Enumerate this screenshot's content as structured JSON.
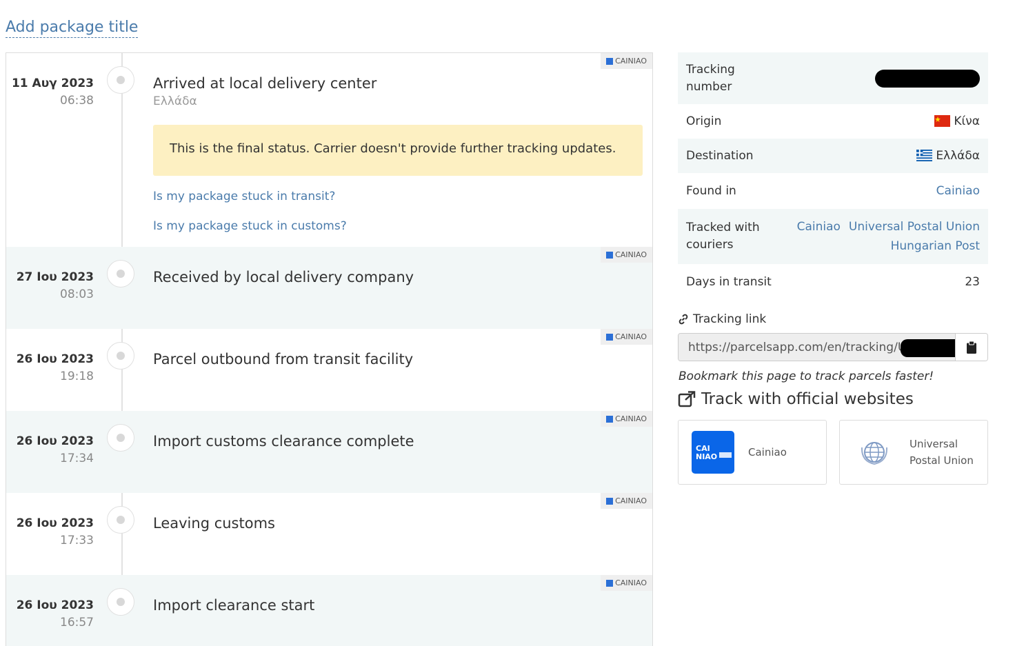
{
  "header": {
    "add_title": "Add package title"
  },
  "events": [
    {
      "date": "11 Αυγ 2023",
      "time": "06:38",
      "status": "Arrived at local delivery center",
      "location": "Ελλάδα",
      "carrier": "CAINIAO"
    },
    {
      "date": "27 Ιου 2023",
      "time": "08:03",
      "status": "Received by local delivery company",
      "carrier": "CAINIAO"
    },
    {
      "date": "26 Ιου 2023",
      "time": "19:18",
      "status": "Parcel outbound from transit facility",
      "carrier": "CAINIAO"
    },
    {
      "date": "26 Ιου 2023",
      "time": "17:34",
      "status": "Import customs clearance complete",
      "carrier": "CAINIAO"
    },
    {
      "date": "26 Ιου 2023",
      "time": "17:33",
      "status": "Leaving customs",
      "carrier": "CAINIAO"
    },
    {
      "date": "26 Ιου 2023",
      "time": "16:57",
      "status": "Import clearance start",
      "carrier": "CAINIAO"
    }
  ],
  "final_notice": "This is the final status. Carrier doesn't provide further tracking updates.",
  "help_links": [
    "Is my package stuck in transit?",
    "Is my package stuck in customs?"
  ],
  "info": {
    "tracking_number_label": "Tracking number",
    "origin_label": "Origin",
    "origin_value": "Κίνα",
    "destination_label": "Destination",
    "destination_value": "Ελλάδα",
    "found_in_label": "Found in",
    "found_in_value": "Cainiao",
    "tracked_with_label": "Tracked with couriers",
    "couriers": [
      "Cainiao",
      "Universal Postal Union",
      "Hungarian Post"
    ],
    "days_label": "Days in transit",
    "days_value": "23"
  },
  "tracking_link": {
    "label": "Tracking link",
    "url": "https://parcelsapp.com/en/tracking/UA"
  },
  "bookmark_text": "Bookmark this page to track parcels faster!",
  "official": {
    "heading": "Track with official websites",
    "sites": [
      "Cainiao",
      "Universal Postal Union"
    ]
  },
  "colors": {
    "link": "#4a7bab",
    "alt_row": "#f2f7f7",
    "notice_bg": "#fdf0c2",
    "cainiao_blue": "#0a66e8"
  }
}
